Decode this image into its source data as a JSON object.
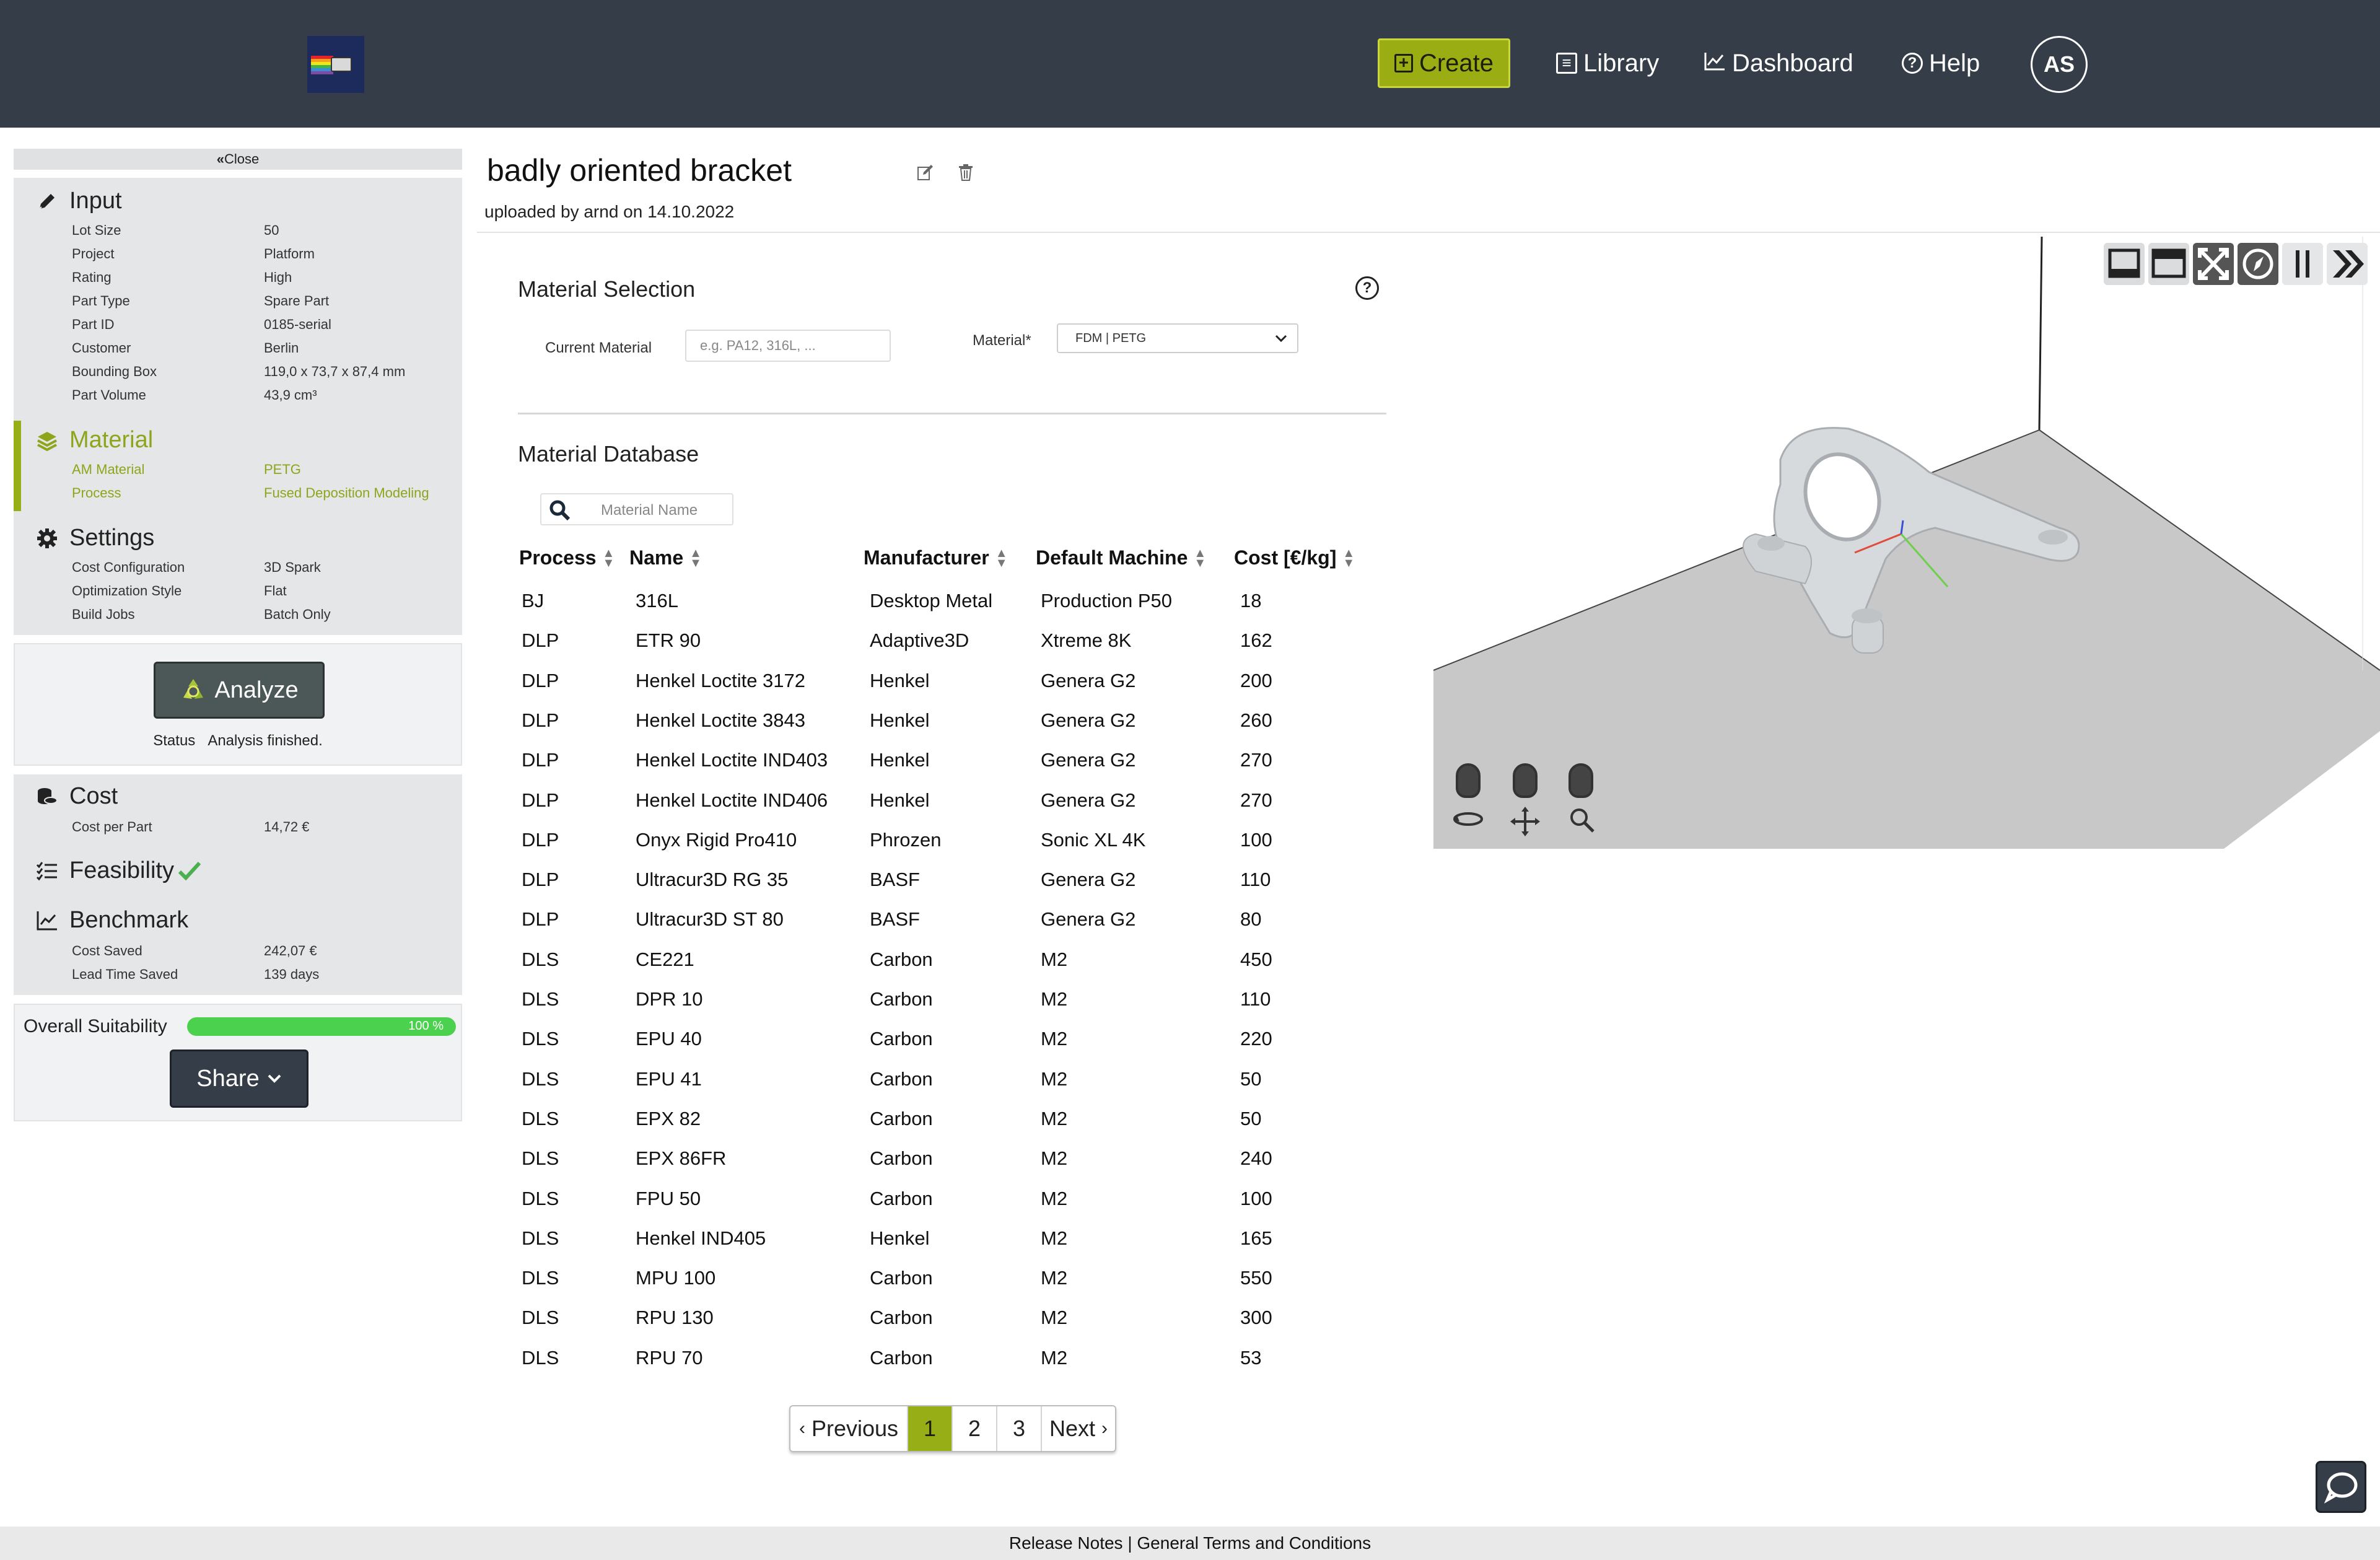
{
  "nav": {
    "create": "Create",
    "library": "Library",
    "dashboard": "Dashboard",
    "help": "Help",
    "avatar": "AS",
    "accent_color": "#9aad12",
    "bar_color": "#353d48"
  },
  "sidebar": {
    "close": "Close",
    "input": {
      "title": "Input",
      "rows": [
        {
          "key": "Lot Size",
          "value": "50"
        },
        {
          "key": "Project",
          "value": "Platform"
        },
        {
          "key": "Rating",
          "value": "High"
        },
        {
          "key": "Part Type",
          "value": "Spare Part"
        },
        {
          "key": "Part ID",
          "value": "0185-serial"
        },
        {
          "key": "Customer",
          "value": "Berlin"
        },
        {
          "key": "Bounding Box",
          "value": "119,0 x 73,7 x 87,4  mm"
        },
        {
          "key": "Part Volume",
          "value": "43,9 cm³"
        }
      ]
    },
    "material": {
      "title": "Material",
      "rows": [
        {
          "key": "AM Material",
          "value": "PETG"
        },
        {
          "key": "Process",
          "value": "Fused Deposition Modeling"
        }
      ]
    },
    "settings": {
      "title": "Settings",
      "rows": [
        {
          "key": "Cost Configuration",
          "value": "3D Spark"
        },
        {
          "key": "Optimization Style",
          "value": "Flat"
        },
        {
          "key": "Build Jobs",
          "value": "Batch Only"
        }
      ]
    },
    "analyze": {
      "button": "Analyze",
      "status_label": "Status",
      "status_value": "Analysis finished."
    },
    "cost": {
      "title": "Cost",
      "rows": [
        {
          "key": "Cost per Part",
          "value": "14,72 €"
        }
      ]
    },
    "feasibility": {
      "title": "Feasibility"
    },
    "benchmark": {
      "title": "Benchmark",
      "rows": [
        {
          "key": "Cost Saved",
          "value": "242,07 €"
        },
        {
          "key": "Lead Time Saved",
          "value": "139 days"
        }
      ]
    },
    "suitability": {
      "label": "Overall Suitability",
      "percent_text": "100 %",
      "percent": 100
    },
    "share": "Share"
  },
  "part": {
    "title": "badly oriented bracket",
    "uploaded": "uploaded by arnd on 14.10.2022"
  },
  "material_selection": {
    "title": "Material Selection",
    "help": "?",
    "current_material_label": "Current Material",
    "current_material_placeholder": "e.g. PA12, 316L, ...",
    "material_label": "Material*",
    "material_value": "FDM | PETG"
  },
  "material_database": {
    "title": "Material Database",
    "search_placeholder": "Material Name",
    "columns": [
      "Process",
      "Name",
      "Manufacturer",
      "Default Machine",
      "Cost [€/kg]"
    ],
    "rows": [
      [
        "BJ",
        "316L",
        "Desktop Metal",
        "Production P50",
        "18"
      ],
      [
        "DLP",
        "ETR 90",
        "Adaptive3D",
        "Xtreme 8K",
        "162"
      ],
      [
        "DLP",
        "Henkel Loctite 3172",
        "Henkel",
        "Genera G2",
        "200"
      ],
      [
        "DLP",
        "Henkel Loctite 3843",
        "Henkel",
        "Genera G2",
        "260"
      ],
      [
        "DLP",
        "Henkel Loctite IND403",
        "Henkel",
        "Genera G2",
        "270"
      ],
      [
        "DLP",
        "Henkel Loctite IND406",
        "Henkel",
        "Genera G2",
        "270"
      ],
      [
        "DLP",
        "Onyx Rigid Pro410",
        "Phrozen",
        "Sonic XL 4K",
        "100"
      ],
      [
        "DLP",
        "Ultracur3D RG 35",
        "BASF",
        "Genera G2",
        "110"
      ],
      [
        "DLP",
        "Ultracur3D ST 80",
        "BASF",
        "Genera G2",
        "80"
      ],
      [
        "DLS",
        "CE221",
        "Carbon",
        "M2",
        "450"
      ],
      [
        "DLS",
        "DPR 10",
        "Carbon",
        "M2",
        "110"
      ],
      [
        "DLS",
        "EPU 40",
        "Carbon",
        "M2",
        "220"
      ],
      [
        "DLS",
        "EPU 41",
        "Carbon",
        "M2",
        "50"
      ],
      [
        "DLS",
        "EPX 82",
        "Carbon",
        "M2",
        "50"
      ],
      [
        "DLS",
        "EPX 86FR",
        "Carbon",
        "M2",
        "240"
      ],
      [
        "DLS",
        "FPU 50",
        "Carbon",
        "M2",
        "100"
      ],
      [
        "DLS",
        "Henkel IND405",
        "Henkel",
        "M2",
        "165"
      ],
      [
        "DLS",
        "MPU 100",
        "Carbon",
        "M2",
        "550"
      ],
      [
        "DLS",
        "RPU 130",
        "Carbon",
        "M2",
        "300"
      ],
      [
        "DLS",
        "RPU 70",
        "Carbon",
        "M2",
        "53"
      ]
    ]
  },
  "pagination": {
    "previous": "Previous",
    "pages": [
      "1",
      "2",
      "3"
    ],
    "active": "1",
    "next": "Next"
  },
  "viewer": {
    "toolbar_icons": [
      "bottom-panel-icon",
      "top-panel-icon",
      "fullscreen-icon",
      "compass-icon",
      "pause-icon",
      "chevrons-right-icon"
    ],
    "mouse_hints": [
      "rotate-mouse-icon",
      "pan-mouse-icon",
      "zoom-mouse-icon"
    ]
  },
  "footer": {
    "release_notes": "Release Notes",
    "separator": "|",
    "terms": "General Terms and Conditions"
  }
}
